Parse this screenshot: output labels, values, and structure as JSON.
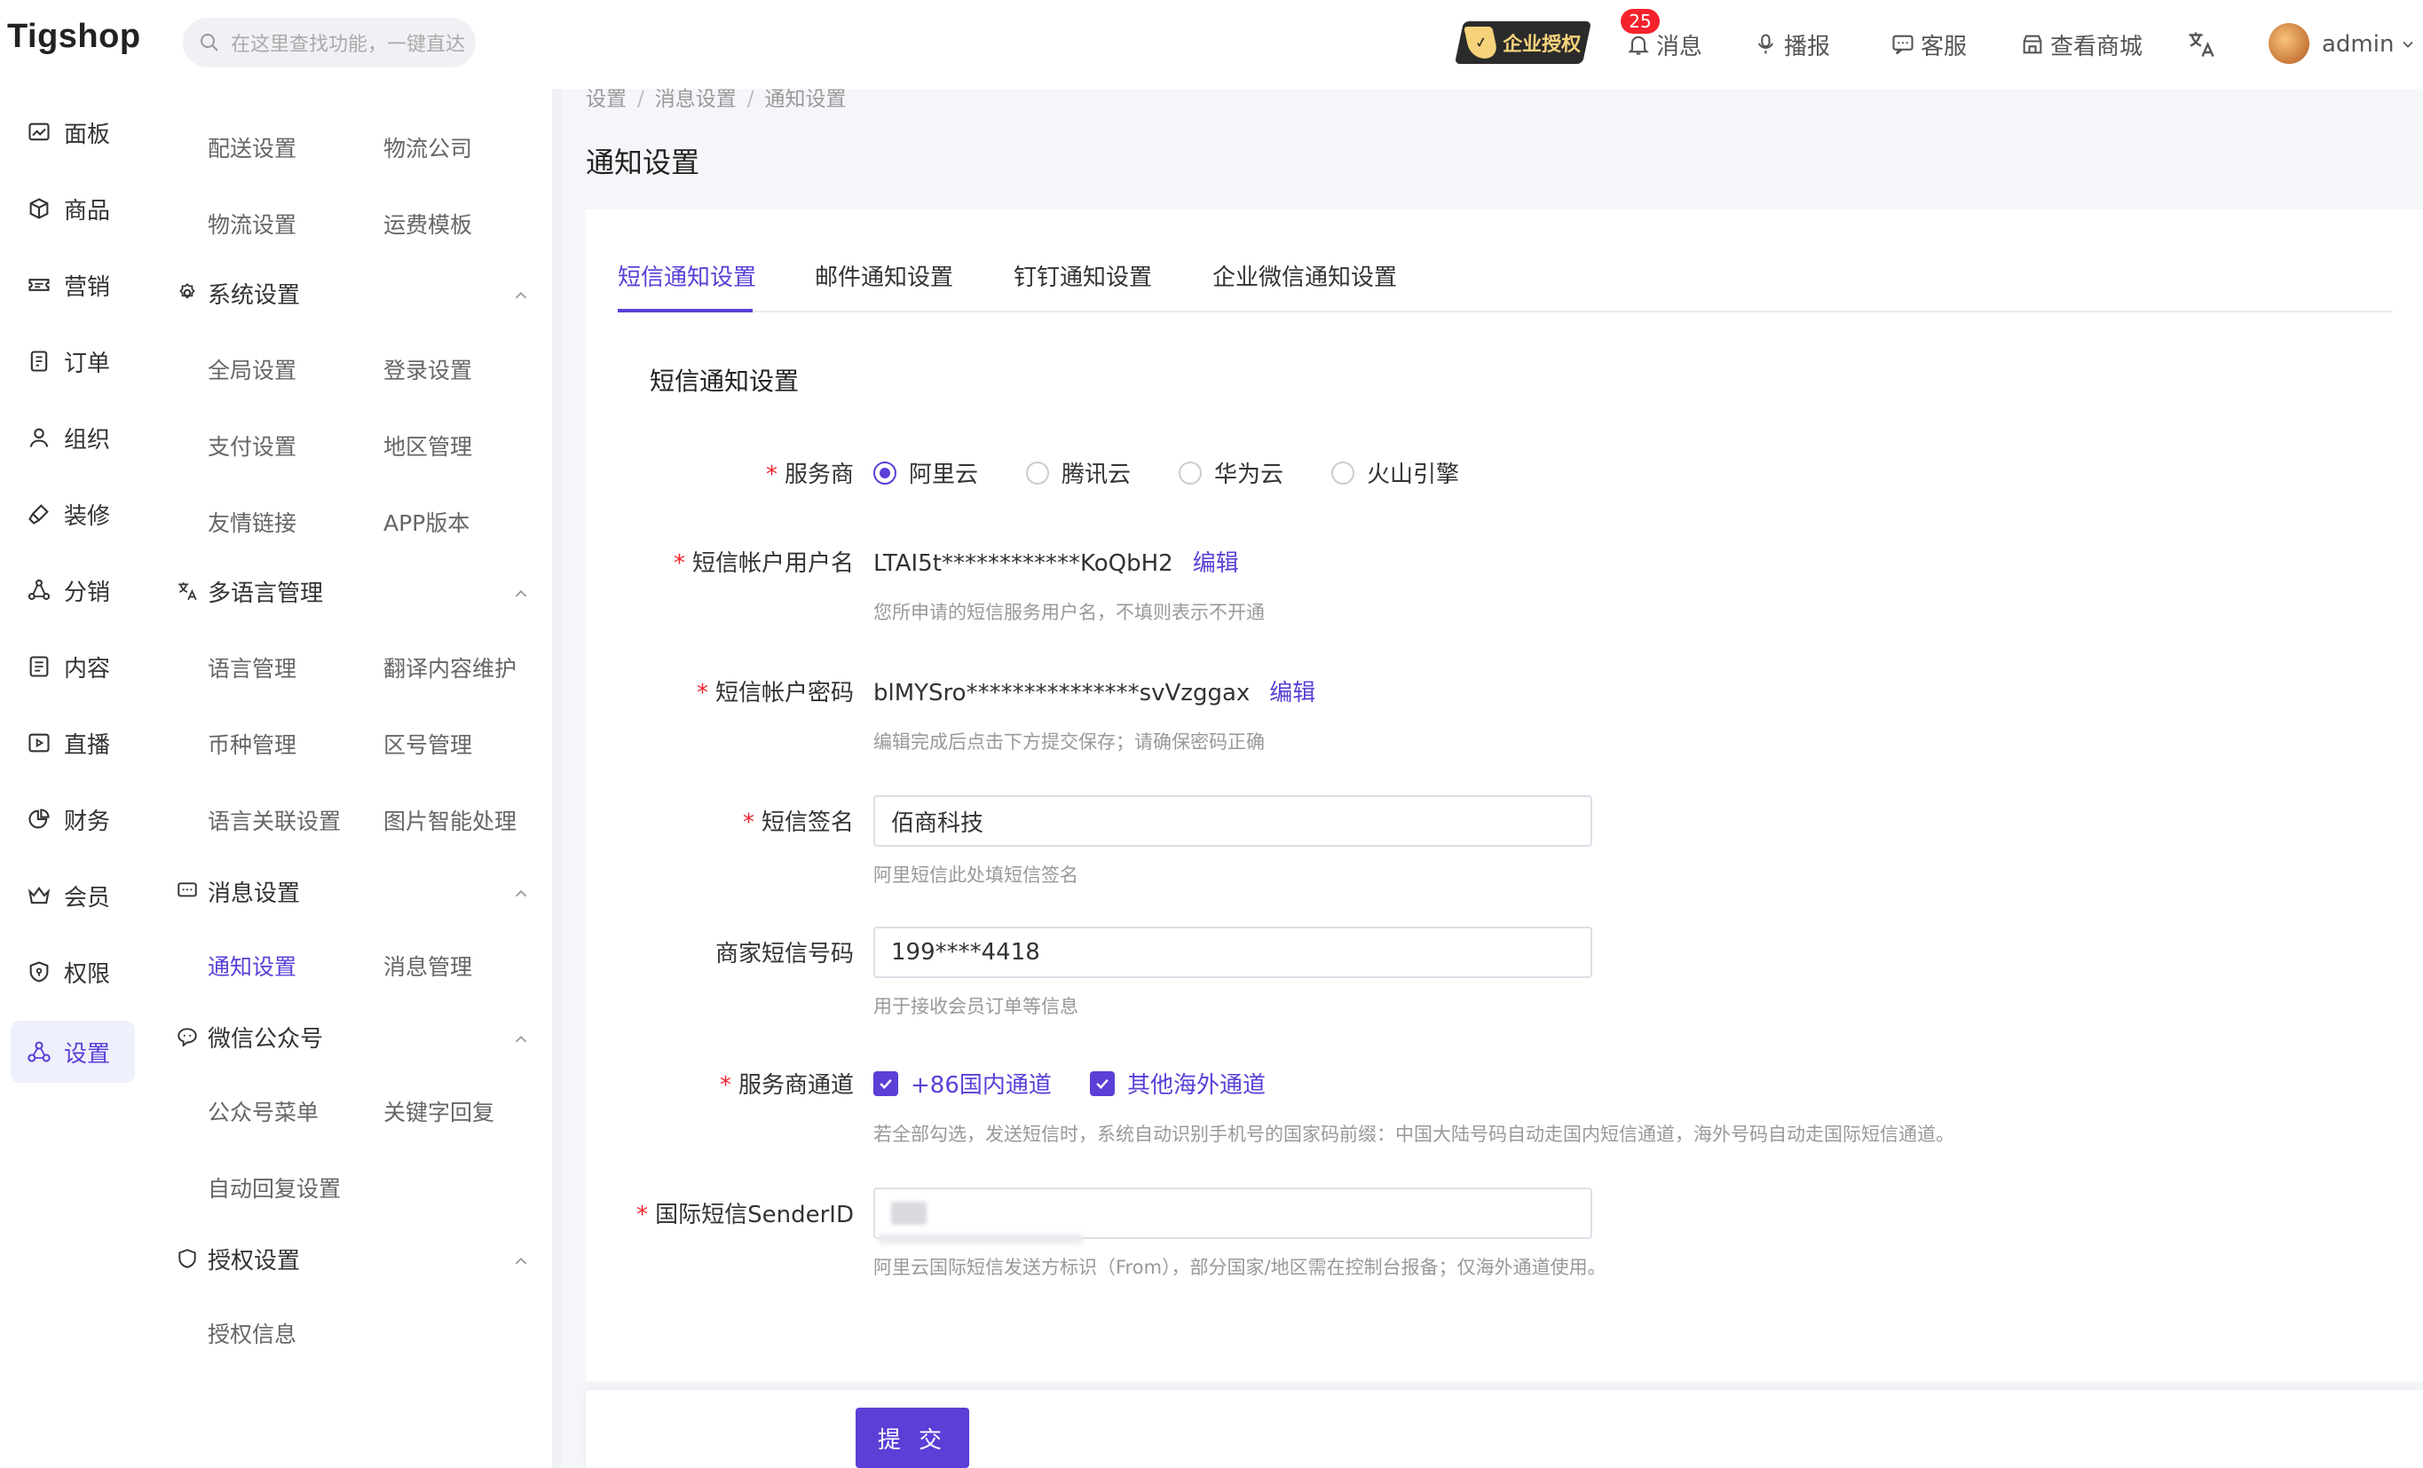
{
  "header": {
    "logo": "Tigshop",
    "search_placeholder": "在这里查找功能，一键直达",
    "auth_badge": "企业授权",
    "notif_count": "25",
    "messages": "消息",
    "broadcast": "播报",
    "service": "客服",
    "view_mall": "查看商城",
    "user": "admin"
  },
  "rail": [
    {
      "label": "面板",
      "icon": "dashboard-icon"
    },
    {
      "label": "商品",
      "icon": "box-icon"
    },
    {
      "label": "营销",
      "icon": "ticket-icon"
    },
    {
      "label": "订单",
      "icon": "order-icon"
    },
    {
      "label": "组织",
      "icon": "user-icon"
    },
    {
      "label": "装修",
      "icon": "brush-icon"
    },
    {
      "label": "分销",
      "icon": "share-icon"
    },
    {
      "label": "内容",
      "icon": "content-icon"
    },
    {
      "label": "直播",
      "icon": "play-icon"
    },
    {
      "label": "财务",
      "icon": "pie-icon"
    },
    {
      "label": "会员",
      "icon": "crown-icon"
    },
    {
      "label": "权限",
      "icon": "shield-icon"
    },
    {
      "label": "设置",
      "icon": "settings-icon"
    }
  ],
  "submenu": {
    "top_links": [
      "配送设置",
      "物流公司",
      "物流设置",
      "运费模板"
    ],
    "system": {
      "title": "系统设置",
      "links": [
        "全局设置",
        "登录设置",
        "支付设置",
        "地区管理",
        "友情链接",
        "APP版本"
      ]
    },
    "i18n": {
      "title": "多语言管理",
      "links": [
        "语言管理",
        "翻译内容维护",
        "币种管理",
        "区号管理",
        "语言关联设置",
        "图片智能处理"
      ]
    },
    "message": {
      "title": "消息设置",
      "links": [
        "通知设置",
        "消息管理"
      ]
    },
    "wechat": {
      "title": "微信公众号",
      "links": [
        "公众号菜单",
        "关键字回复",
        "自动回复设置"
      ]
    },
    "license": {
      "title": "授权设置",
      "links": [
        "授权信息"
      ]
    }
  },
  "breadcrumb": [
    "设置",
    "消息设置",
    "通知设置"
  ],
  "page_title": "通知设置",
  "tabs": [
    "短信通知设置",
    "邮件通知设置",
    "钉钉通知设置",
    "企业微信通知设置"
  ],
  "form": {
    "section_title": "短信通知设置",
    "provider_label": "服务商",
    "providers": [
      "阿里云",
      "腾讯云",
      "华为云",
      "火山引擎"
    ],
    "username_label": "短信帐户用户名",
    "username_value": "LTAI5t************KoQbH2",
    "edit": "编辑",
    "username_help": "您所申请的短信服务用户名，不填则表示不开通",
    "password_label": "短信帐户密码",
    "password_value": "blMYSro***************svVzggax",
    "password_help": "编辑完成后点击下方提交保存；请确保密码正确",
    "sign_label": "短信签名",
    "sign_value": "佰商科技",
    "sign_help": "阿里短信此处填短信签名",
    "phone_label": "商家短信号码",
    "phone_value": "199****4418",
    "phone_help": "用于接收会员订单等信息",
    "channel_label": "服务商通道",
    "channels": [
      "+86国内通道",
      "其他海外通道"
    ],
    "channel_help": "若全部勾选，发送短信时，系统自动识别手机号的国家码前缀：中国大陆号码自动走国内短信通道，海外号码自动走国际短信通道。",
    "sender_label": "国际短信SenderID",
    "sender_help": "阿里云国际短信发送方标识（From），部分国家/地区需在控制台报备；仅海外通道使用。"
  },
  "submit": "提 交",
  "colors": {
    "accent": "#5b3fd6",
    "required": "#f5222d",
    "badge": "#f5222d"
  }
}
